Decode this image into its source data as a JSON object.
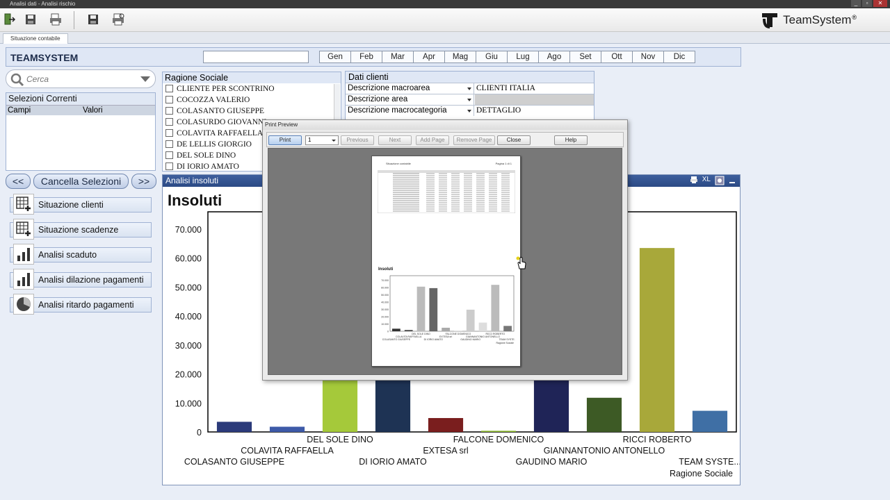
{
  "window": {
    "title": "Analisi dati - Analisi rischio",
    "controls": [
      "_",
      "▫",
      "✕"
    ]
  },
  "toolbar": {
    "icons": [
      "exit-icon",
      "save-all-icon",
      "print-icon",
      "save-icon",
      "print-preview-icon"
    ],
    "logo_text": "TeamSystem",
    "logo_mark": "®"
  },
  "tabs": [
    {
      "label": "Situazione contabile",
      "active": true
    }
  ],
  "header": {
    "title": "TEAMSYSTEM",
    "input_value": "",
    "months": [
      "Gen",
      "Feb",
      "Mar",
      "Apr",
      "Mag",
      "Giu",
      "Lug",
      "Ago",
      "Set",
      "Ott",
      "Nov",
      "Dic"
    ]
  },
  "search": {
    "placeholder": "Cerca"
  },
  "selezioni": {
    "title": "Selezioni Correnti",
    "col_campi": "Campi",
    "col_valori": "Valori"
  },
  "nav": {
    "prev_label": "<<",
    "clear_label": "Cancella Selezioni",
    "next_label": ">>"
  },
  "menu": [
    {
      "label": "Situazione clienti",
      "icon": "table-add-icon"
    },
    {
      "label": "Situazione scadenze",
      "icon": "table-add-icon"
    },
    {
      "label": "Analisi scaduto",
      "icon": "bar-chart-icon"
    },
    {
      "label": "Analisi dilazione pagamenti",
      "icon": "bar-chart-icon"
    },
    {
      "label": "Analisi ritardo pagamenti",
      "icon": "pie-chart-icon"
    }
  ],
  "ragione_sociale": {
    "title": "Ragione Sociale",
    "items": [
      "CLIENTE PER SCONTRINO",
      "COCOZZA VALERIO",
      "COLASANTO GIUSEPPE",
      "COLASURDO GIOVANNI",
      "COLAVITA RAFFAELLA",
      "DE LELLIS GIORGIO",
      "DEL SOLE DINO",
      "DI IORIO AMATO"
    ]
  },
  "dati_clienti": {
    "title": "Dati clienti",
    "rows": [
      {
        "key": "Descrizione macroarea",
        "value": "CLIENTI ITALIA"
      },
      {
        "key": "Descrizione area",
        "value": ""
      },
      {
        "key": "Descrizione macrocategoria",
        "value": "DETTAGLIO"
      }
    ]
  },
  "analisi": {
    "title": "Analisi insoluti",
    "icons": [
      "print-icon",
      "excel-icon",
      "restore-icon",
      "minimize-icon"
    ],
    "excel_label": "XL"
  },
  "chart_data": {
    "type": "bar",
    "title": "Insoluti",
    "xlabel": "Ragione Sociale",
    "ylabel": "",
    "ylim": [
      0,
      76000
    ],
    "yticks": [
      0,
      10000,
      20000,
      30000,
      40000,
      50000,
      60000,
      70000
    ],
    "ytick_labels": [
      "0",
      "10.000",
      "20.000",
      "30.000",
      "40.000",
      "50.000",
      "60.000",
      "70.000"
    ],
    "grid": false,
    "categories": [
      "COLASANTO GIUSEPPE",
      "COLAVITA RAFFAELLA",
      "DEL SOLE DINO",
      "DI IORIO AMATO",
      "EXTESA srl",
      "FALCONE DOMENICO",
      "GAUDINO MARIO",
      "GIANNANTONIO ANTONELLO",
      "RICCI ROBERTO",
      "TEAM SYSTE..."
    ],
    "values": [
      3500,
      1800,
      61000,
      59000,
      4800,
      400,
      29500,
      11800,
      63500,
      7300
    ],
    "colors": [
      "#2b3a7a",
      "#3d5aa8",
      "#a5c93a",
      "#1e3354",
      "#7a1e1e",
      "#8ab52e",
      "#1f2457",
      "#3d5a25",
      "#a8a83a",
      "#3f6fa5"
    ]
  },
  "print_preview": {
    "title": "Print Preview",
    "print_label": "Print",
    "page_value": "1",
    "previous_label": "Previous",
    "next_label": "Next",
    "add_page_label": "Add Page",
    "remove_page_label": "Remove Page",
    "close_label": "Close",
    "help_label": "Help",
    "page_header_left": "Situazione contabile",
    "page_header_right": "Pagina 1 di 1",
    "chart_title": "Insoluti",
    "chart_values": [
      3500,
      1800,
      61000,
      59000,
      4800,
      400,
      29500,
      11800,
      63500,
      7300
    ],
    "chart_colors": [
      "#333",
      "#555",
      "#bbb",
      "#666",
      "#aaa",
      "#ccc",
      "#ccc",
      "#ddd",
      "#bbb",
      "#777"
    ],
    "chart_yticks": [
      "0",
      "10.000",
      "20.000",
      "30.000",
      "40.000",
      "50.000",
      "60.000",
      "70.000"
    ]
  }
}
